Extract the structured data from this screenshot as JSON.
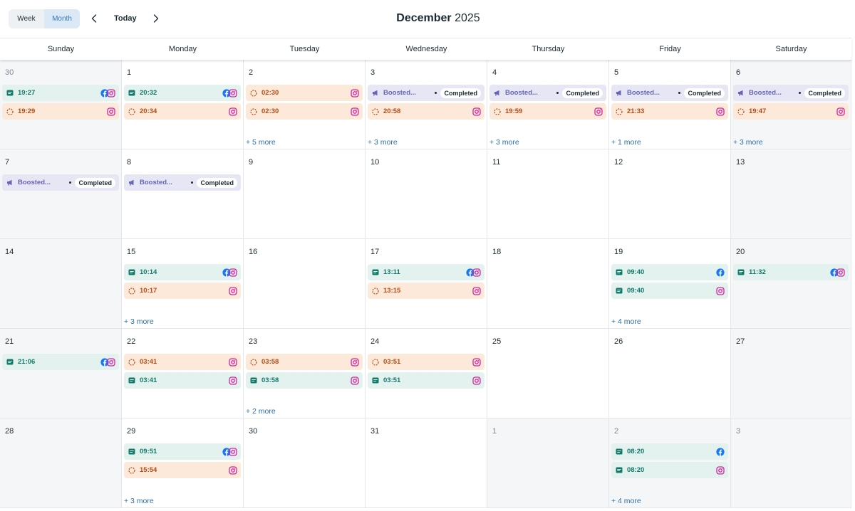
{
  "toolbar": {
    "week_label": "Week",
    "month_label": "Month",
    "today_label": "Today",
    "month_name": "December",
    "year": "2025"
  },
  "colors": {
    "post_bg": "#e3f2ee",
    "post_text": "#127a6b",
    "story_bg": "#fde9da",
    "story_text": "#b84a12",
    "ad_bg": "#e6e6f5",
    "ad_text": "#6666b3",
    "facebook": "#1877f2",
    "instagram": "#d6249f",
    "link": "#2d6fa8"
  },
  "weekdays": [
    "Sunday",
    "Monday",
    "Tuesday",
    "Wednesday",
    "Thursday",
    "Friday",
    "Saturday"
  ],
  "weeks": [
    [
      {
        "day": "30",
        "outside": true,
        "events": [
          {
            "type": "post",
            "time": "19:27",
            "platforms": [
              "facebook",
              "instagram"
            ]
          },
          {
            "type": "story",
            "time": "19:29",
            "platforms": [
              "instagram"
            ]
          }
        ]
      },
      {
        "day": "1",
        "events": [
          {
            "type": "post",
            "time": "20:32",
            "platforms": [
              "facebook",
              "instagram"
            ]
          },
          {
            "type": "story",
            "time": "20:34",
            "platforms": [
              "instagram"
            ]
          }
        ]
      },
      {
        "day": "2",
        "events": [
          {
            "type": "story",
            "time": "02:30",
            "platforms": [
              "instagram"
            ]
          },
          {
            "type": "story",
            "time": "02:30",
            "platforms": [
              "instagram"
            ]
          }
        ],
        "more": "+ 5 more"
      },
      {
        "day": "3",
        "events": [
          {
            "type": "ad",
            "title": "Boosted...",
            "status": "Completed"
          },
          {
            "type": "story",
            "time": "20:58",
            "platforms": [
              "instagram"
            ]
          }
        ],
        "more": "+ 3 more"
      },
      {
        "day": "4",
        "events": [
          {
            "type": "ad",
            "title": "Boosted...",
            "status": "Completed"
          },
          {
            "type": "story",
            "time": "19:59",
            "platforms": [
              "instagram"
            ]
          }
        ],
        "more": "+ 3 more"
      },
      {
        "day": "5",
        "events": [
          {
            "type": "ad",
            "title": "Boosted...",
            "status": "Completed"
          },
          {
            "type": "story",
            "time": "21:33",
            "platforms": [
              "instagram"
            ]
          }
        ],
        "more": "+ 1 more"
      },
      {
        "day": "6",
        "events": [
          {
            "type": "ad",
            "title": "Boosted...",
            "status": "Completed"
          },
          {
            "type": "story",
            "time": "19:47",
            "platforms": [
              "instagram"
            ]
          }
        ],
        "more": "+ 3 more"
      }
    ],
    [
      {
        "day": "7",
        "events": [
          {
            "type": "ad",
            "title": "Boosted...",
            "status": "Completed"
          }
        ]
      },
      {
        "day": "8",
        "events": [
          {
            "type": "ad",
            "title": "Boosted...",
            "status": "Completed"
          }
        ]
      },
      {
        "day": "9",
        "events": []
      },
      {
        "day": "10",
        "events": []
      },
      {
        "day": "11",
        "events": []
      },
      {
        "day": "12",
        "events": []
      },
      {
        "day": "13",
        "events": []
      }
    ],
    [
      {
        "day": "14",
        "events": []
      },
      {
        "day": "15",
        "events": [
          {
            "type": "post",
            "time": "10:14",
            "platforms": [
              "facebook",
              "instagram"
            ]
          },
          {
            "type": "story",
            "time": "10:17",
            "platforms": [
              "instagram"
            ]
          }
        ],
        "more": "+ 3 more"
      },
      {
        "day": "16",
        "events": []
      },
      {
        "day": "17",
        "events": [
          {
            "type": "post",
            "time": "13:11",
            "platforms": [
              "facebook",
              "instagram"
            ]
          },
          {
            "type": "story",
            "time": "13:15",
            "platforms": [
              "instagram"
            ]
          }
        ]
      },
      {
        "day": "18",
        "events": []
      },
      {
        "day": "19",
        "events": [
          {
            "type": "post",
            "time": "09:40",
            "platforms": [
              "facebook"
            ]
          },
          {
            "type": "post",
            "time": "09:40",
            "platforms": [
              "instagram"
            ]
          }
        ],
        "more": "+ 4 more"
      },
      {
        "day": "20",
        "events": [
          {
            "type": "post",
            "time": "11:32",
            "platforms": [
              "facebook",
              "instagram"
            ]
          }
        ]
      }
    ],
    [
      {
        "day": "21",
        "events": [
          {
            "type": "post",
            "time": "21:06",
            "platforms": [
              "facebook",
              "instagram"
            ]
          }
        ]
      },
      {
        "day": "22",
        "events": [
          {
            "type": "story",
            "time": "03:41",
            "platforms": [
              "instagram"
            ]
          },
          {
            "type": "post",
            "time": "03:41",
            "platforms": [
              "instagram"
            ]
          }
        ]
      },
      {
        "day": "23",
        "events": [
          {
            "type": "story",
            "time": "03:58",
            "platforms": [
              "instagram"
            ]
          },
          {
            "type": "post",
            "time": "03:58",
            "platforms": [
              "instagram"
            ]
          }
        ],
        "more": "+ 2 more"
      },
      {
        "day": "24",
        "events": [
          {
            "type": "story",
            "time": "03:51",
            "platforms": [
              "instagram"
            ]
          },
          {
            "type": "post",
            "time": "03:51",
            "platforms": [
              "instagram"
            ]
          }
        ]
      },
      {
        "day": "25",
        "events": []
      },
      {
        "day": "26",
        "events": []
      },
      {
        "day": "27",
        "events": []
      }
    ],
    [
      {
        "day": "28",
        "events": []
      },
      {
        "day": "29",
        "events": [
          {
            "type": "post",
            "time": "09:51",
            "platforms": [
              "facebook",
              "instagram"
            ]
          },
          {
            "type": "story",
            "time": "15:54",
            "platforms": [
              "instagram"
            ]
          }
        ],
        "more": "+ 3 more"
      },
      {
        "day": "30",
        "events": []
      },
      {
        "day": "31",
        "events": []
      },
      {
        "day": "1",
        "outside": true,
        "events": []
      },
      {
        "day": "2",
        "outside": true,
        "events": [
          {
            "type": "post",
            "time": "08:20",
            "platforms": [
              "facebook"
            ]
          },
          {
            "type": "post",
            "time": "08:20",
            "platforms": [
              "instagram"
            ]
          }
        ],
        "more": "+ 4 more"
      },
      {
        "day": "3",
        "outside": true,
        "events": []
      }
    ]
  ]
}
